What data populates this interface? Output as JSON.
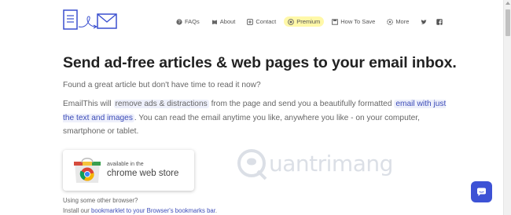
{
  "nav": {
    "faqs": "FAQs",
    "about": "About",
    "contact": "Contact",
    "premium": "Premium",
    "how_to_save": "How To Save",
    "more": "More",
    "icons": [
      "question-circle-icon",
      "book-icon",
      "plus-square-icon",
      "star-icon",
      "save-icon",
      "gear-icon",
      "twitter-icon",
      "facebook-icon"
    ]
  },
  "main": {
    "headline": "Send ad-free articles & web pages to your email inbox.",
    "subhead": "Found a great article but don't have time to read it now?",
    "para": {
      "p1": "EmailThis will ",
      "hl1": "remove ads & distractions",
      "p2": " from the page and send you a beautifully formatted ",
      "hl2": "email with just the text and images",
      "p3": ". You can read the email anytime you like, anywhere you like - on your computer, smartphone or tablet."
    }
  },
  "chrome_store": {
    "available": "available in the",
    "store": "chrome web store"
  },
  "other_browser": {
    "line1": "Using some other browser?",
    "line2_prefix": "Install our ",
    "line2_link": "bookmarklet to your Browser's bookmarks bar",
    "line2_suffix": "."
  },
  "watermark": "uantrimang",
  "colors": {
    "accent": "#3d52d5",
    "premium_bg": "#fff8a8",
    "highlight_bg": "#eef0fb",
    "link": "#3d4db8"
  }
}
